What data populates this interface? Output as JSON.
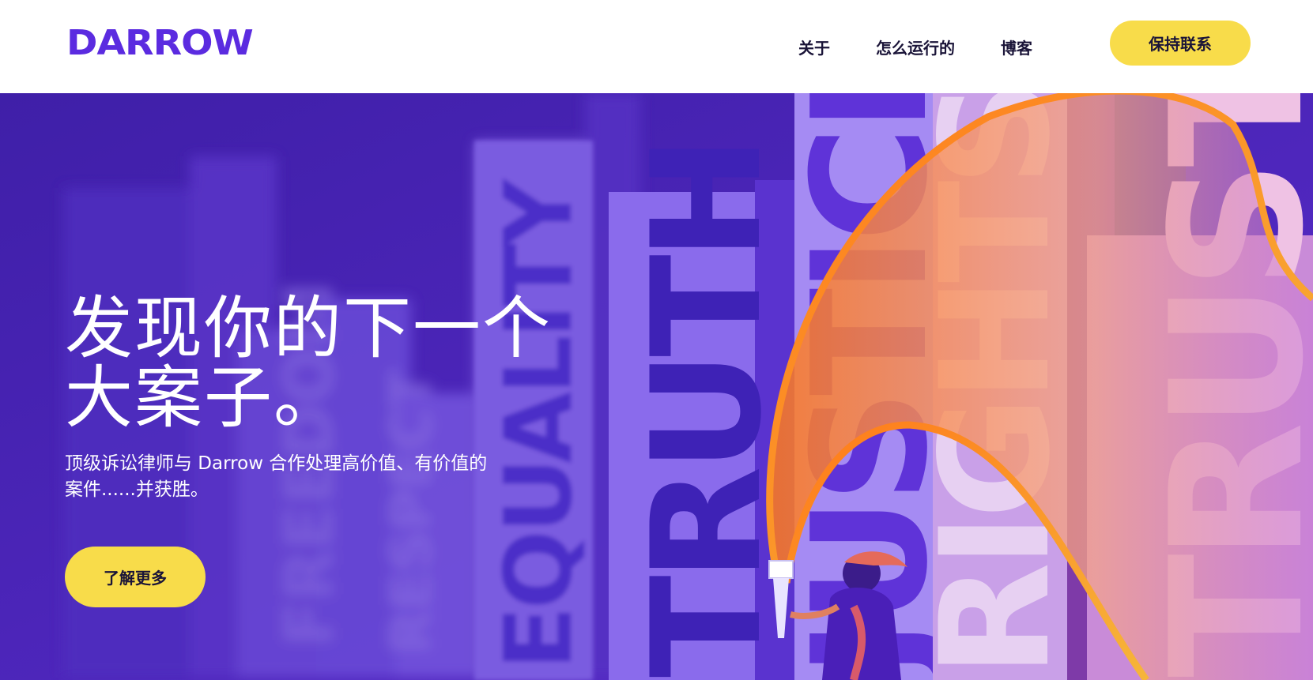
{
  "brand": {
    "name": "DARROW"
  },
  "nav": {
    "items": [
      {
        "label": "关于"
      },
      {
        "label": "怎么运行的"
      },
      {
        "label": "博客"
      }
    ],
    "cta_label": "保持联系"
  },
  "hero": {
    "title_line1": "发现你的下一个",
    "title_line2": "大案子。",
    "subtitle": "顶级诉讼律师与 Darrow 合作处理高价值、有价值的案件......并获胜。",
    "button_label": "了解更多",
    "illustration_words": [
      "EQUALITY",
      "TRUTH",
      "JUSTICE",
      "RIGHTS",
      "TRUST",
      "RESPECT",
      "FREEDOM"
    ]
  },
  "colors": {
    "brand_purple": "#5b2be0",
    "hero_bg": "#4b26b4",
    "accent_yellow": "#f8dc4a",
    "accent_orange": "#ff7a1a",
    "text_dark": "#1a1438"
  }
}
